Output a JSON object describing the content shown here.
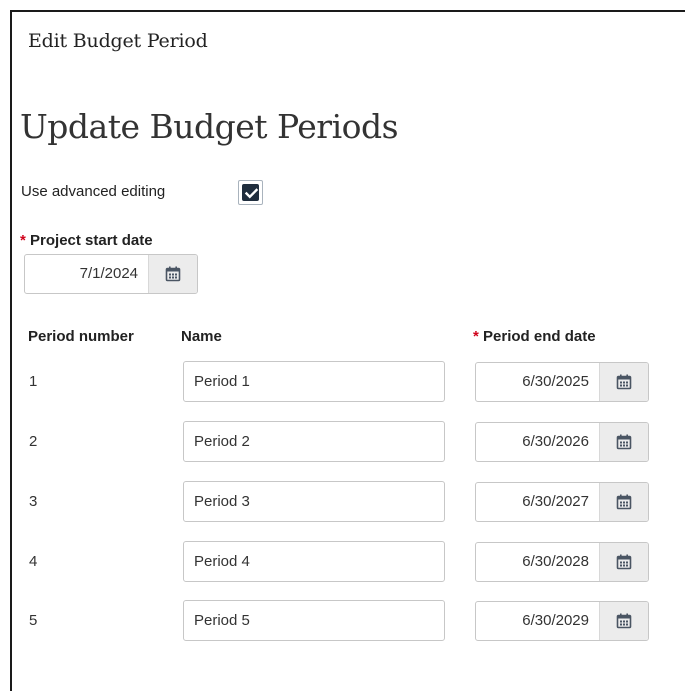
{
  "dialog": {
    "title": "Edit Budget Period"
  },
  "page": {
    "heading": "Update Budget Periods"
  },
  "advanced_editing": {
    "label": "Use advanced editing",
    "checked": true
  },
  "project_start": {
    "required_marker": "*",
    "label": "Project start date",
    "value": "7/1/2024"
  },
  "table": {
    "headers": {
      "period_number": "Period number",
      "name": "Name",
      "end_date_required": "*",
      "end_date": "Period end date"
    },
    "rows": [
      {
        "number": "1",
        "name": "Period 1",
        "end_date": "6/30/2025"
      },
      {
        "number": "2",
        "name": "Period 2",
        "end_date": "6/30/2026"
      },
      {
        "number": "3",
        "name": "Period 3",
        "end_date": "6/30/2027"
      },
      {
        "number": "4",
        "name": "Period 4",
        "end_date": "6/30/2028"
      },
      {
        "number": "5",
        "name": "Period 5",
        "end_date": "6/30/2029"
      }
    ]
  },
  "icons": {
    "calendar": "calendar-icon",
    "checkmark": "checkmark-icon"
  },
  "colors": {
    "checkbox_fill": "#1f2d3d",
    "required_asterisk": "#d0021b",
    "calendar_button_bg": "#ececec",
    "calendar_icon": "#4a5563"
  }
}
